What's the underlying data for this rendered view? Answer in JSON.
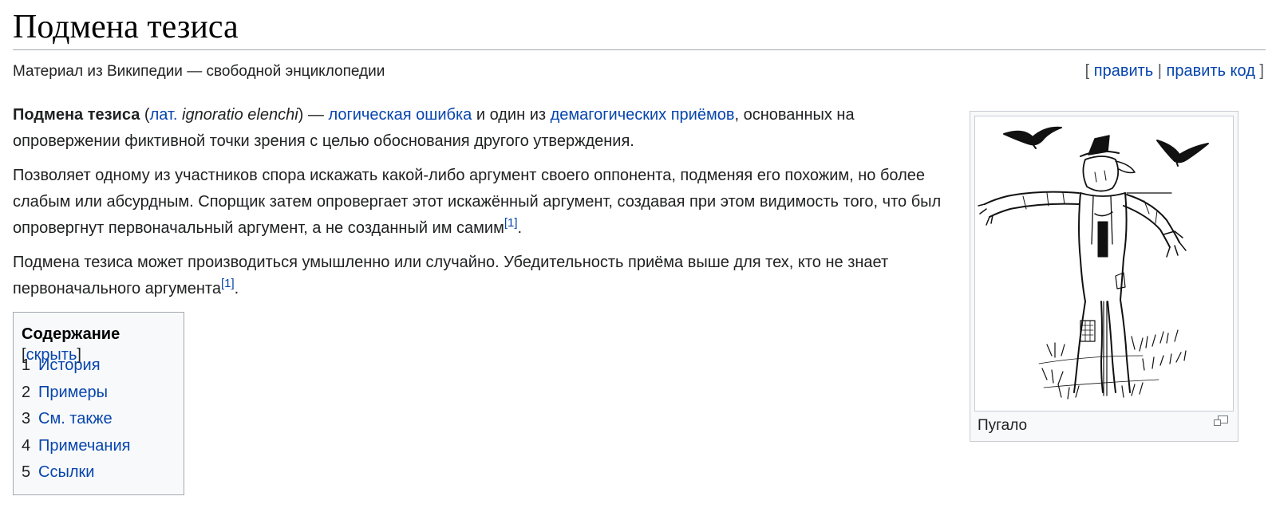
{
  "header": {
    "title": "Подмена тезиса",
    "tagline": "Материал из Википедии — свободной энциклопедии",
    "edit_links": {
      "open": "[ ",
      "edit": "править",
      "sep": " | ",
      "edit_code": "править код",
      "close": " ]"
    }
  },
  "intro": {
    "term": "Подмена тезиса",
    "open_paren": " (",
    "lat_abbr": "лат.",
    "lat_term": "ignoratio elenchi",
    "close_dash": ") — ",
    "link_fallacy": "логическая ошибка",
    "mid_text": " и один из ",
    "link_demagogic": "демагогических приёмов",
    "rest": ", основанных на опровержении фиктивной точки зрения с целью обоснования другого утверждения."
  },
  "para2": {
    "text": "Позволяет одному из участников спора искажать какой-либо аргумент своего оппонента, подменяя его похожим, но более слабым или абсурдным. Спорщик затем опровергает этот искажённый аргумент, создавая при этом видимость того, что был опровергнут первоначальный аргумент, а не созданный им самим",
    "ref": "[1]",
    "end": "."
  },
  "para3": {
    "text": "Подмена тезиса может производиться умышленно или случайно. Убедительность приёма выше для тех, кто не знает первоначального аргумента",
    "ref": "[1]",
    "end": "."
  },
  "toc": {
    "title": "Содержание",
    "toggle_open": " [",
    "toggle": "скрыть",
    "toggle_close": "]",
    "items": [
      {
        "num": "1",
        "label": "История"
      },
      {
        "num": "2",
        "label": "Примеры"
      },
      {
        "num": "3",
        "label": "См. также"
      },
      {
        "num": "4",
        "label": "Примечания"
      },
      {
        "num": "5",
        "label": "Ссылки"
      }
    ]
  },
  "thumbnail": {
    "caption": "Пугало",
    "image_icon": "scarecrow-drawing",
    "enlarge_icon": "magnify-icon"
  },
  "colors": {
    "link": "#0645ad",
    "text": "#202122",
    "border": "#a2a9b1",
    "box_bg": "#f8f9fa"
  }
}
